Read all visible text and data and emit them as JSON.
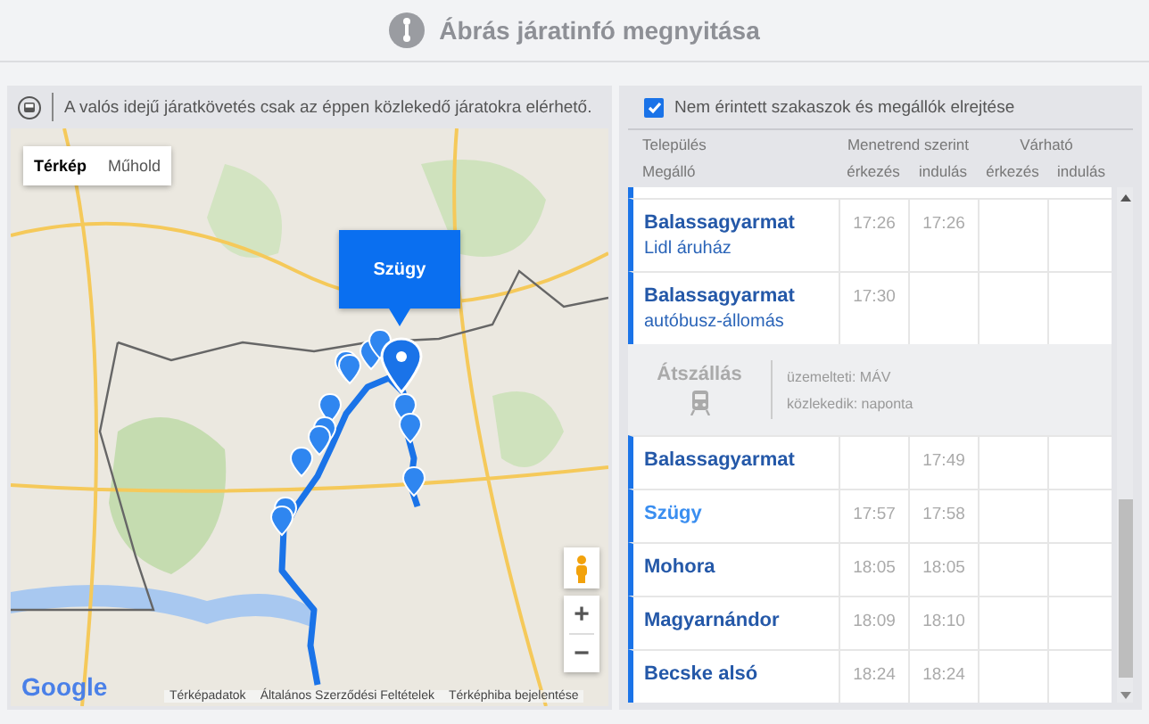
{
  "header": {
    "title": "Ábrás járatinfó megnyitása"
  },
  "map": {
    "notice": "A valós idejű járatkövetés csak az éppen közlekedő járatokra elérhető.",
    "map_types": [
      {
        "label": "Térkép",
        "selected": true
      },
      {
        "label": "Műhold",
        "selected": false
      }
    ],
    "popup": "Szügy",
    "zoom_in": "+",
    "zoom_out": "−",
    "logo": "Google",
    "attribution": [
      "Térképadatok",
      "Általános Szerződési Feltételek",
      "Térképhiba bejelentése"
    ]
  },
  "timetable": {
    "hide_option": {
      "label": "Nem érintett szakaszok és megállók elrejtése",
      "checked": true
    },
    "headings": {
      "place": "Település",
      "stop": "Megálló",
      "scheduled": "Menetrend szerint",
      "expected": "Várható",
      "arrival": "érkezés",
      "departure": "indulás",
      "expected_arrival": "érkezés",
      "expected_departure": "indulás"
    },
    "rows": [
      {
        "kind": "stop",
        "name": "Balassagyarmat",
        "stop": "Lidl áruház",
        "arrival": "17:26",
        "departure": "17:26",
        "selected": false
      },
      {
        "kind": "stop",
        "name": "Balassagyarmat",
        "stop": "autóbusz-állomás",
        "arrival": "17:30",
        "selected": false
      },
      {
        "kind": "transfer",
        "label": "Átszállás",
        "operator": "üzemelteti: MÁV",
        "schedule": "közlekedik: naponta"
      },
      {
        "kind": "stop",
        "name": "Balassagyarmat",
        "departure": "17:49",
        "selected": false
      },
      {
        "kind": "stop",
        "name": "Szügy",
        "arrival": "17:57",
        "departure": "17:58",
        "selected": true
      },
      {
        "kind": "stop",
        "name": "Mohora",
        "arrival": "18:05",
        "departure": "18:05",
        "selected": false
      },
      {
        "kind": "stop",
        "name": "Magyarnándor",
        "arrival": "18:09",
        "departure": "18:10",
        "selected": false
      },
      {
        "kind": "stop",
        "name": "Becske alsó",
        "arrival": "18:24",
        "departure": "18:24",
        "selected": false
      }
    ]
  }
}
